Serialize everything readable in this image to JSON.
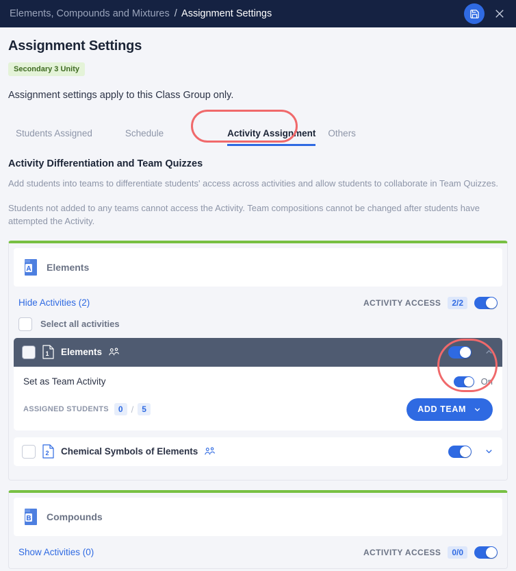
{
  "topbar": {
    "breadcrumb_parent": "Elements, Compounds and Mixtures",
    "breadcrumb_separator": "/",
    "breadcrumb_current": "Assignment Settings",
    "save_icon": "save-floppy-icon",
    "close_icon": "close-icon"
  },
  "page": {
    "title": "Assignment Settings",
    "class_badge": "Secondary 3 Unity",
    "subtitle": "Assignment settings apply to this Class Group only."
  },
  "tabs": [
    {
      "label": "Students Assigned",
      "active": false
    },
    {
      "label": "Schedule",
      "active": false
    },
    {
      "label": "Activity Assignment",
      "active": true
    },
    {
      "label": "Others",
      "active": false
    }
  ],
  "section": {
    "title": "Activity Differentiation and Team Quizzes",
    "paragraph1": "Add students into teams to differentiate students' access across activities and allow students to collaborate in Team Quizzes.",
    "paragraph2": "Students not added to any teams cannot access the Activity. Team compositions cannot be changed after students have attempted the Activity."
  },
  "chapters": [
    {
      "letter": "A",
      "name": "Elements",
      "toggle_link": "Hide Activities (2)",
      "access_label": "ACTIVITY ACCESS",
      "access_count": "2/2",
      "access_on": true,
      "select_all_label": "Select all activities",
      "select_all_checked": false,
      "expanded": true,
      "activities": [
        {
          "number": "1",
          "name": "Elements",
          "team_icon": "people-group-icon",
          "toggle_on": true,
          "chevron": "chevron-up-icon",
          "selected": true,
          "expanded": true,
          "team_activity_label": "Set as Team Activity",
          "team_activity_on": true,
          "team_activity_state_text": "On",
          "assigned_students_label": "ASSIGNED STUDENTS",
          "assigned_count": "0",
          "assigned_separator": "/",
          "assigned_total": "5",
          "add_team_label": "ADD TEAM"
        },
        {
          "number": "2",
          "name": "Chemical Symbols of Elements",
          "team_icon": "people-group-icon",
          "toggle_on": true,
          "chevron": "chevron-down-icon",
          "selected": false,
          "expanded": false
        }
      ]
    },
    {
      "letter": "B",
      "name": "Compounds",
      "toggle_link": "Show Activities (0)",
      "access_label": "ACTIVITY ACCESS",
      "access_count": "0/0",
      "access_on": true,
      "expanded": false,
      "activities": []
    }
  ],
  "colors": {
    "topbar": "#152242",
    "accent_blue": "#2f6ae2",
    "chapter_top_green": "#78c043",
    "badge_green_bg": "#e4f3d8",
    "badge_green_text": "#3f6b22",
    "activity_dark": "#4f5b71",
    "annotation_red": "#f0696b"
  }
}
